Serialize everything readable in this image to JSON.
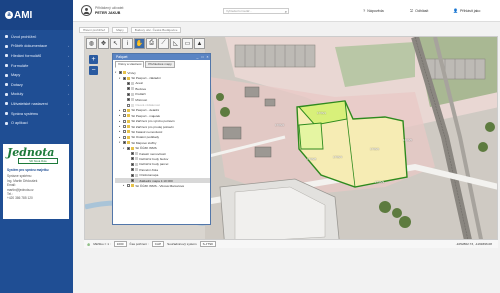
{
  "app": {
    "logo": "AMI",
    "logo_mark": "a"
  },
  "sidebar": {
    "items": [
      {
        "label": "Úvod prohlížeč",
        "has_children": false
      },
      {
        "label": "Průběh dokumentace",
        "has_children": true
      },
      {
        "label": "Hledání formulářů",
        "has_children": true
      },
      {
        "label": "Formuláře",
        "has_children": true
      },
      {
        "label": "Mapy",
        "has_children": true
      },
      {
        "label": "Dotazy",
        "has_children": true
      },
      {
        "label": "Moduly",
        "has_children": true
      },
      {
        "label": "Uživatelské nastavení",
        "has_children": true
      },
      {
        "label": "Správa systému",
        "has_children": true
      },
      {
        "label": "O aplikaci",
        "has_children": false
      }
    ],
    "branding": {
      "logo": "Jednota",
      "logo_sub": "SD Nová Role",
      "title": "Systém pro správu majetku",
      "lines": [
        "Správce systému",
        "Ing. Martin Dědoušek",
        "Email:",
        "martin@jednota.cz",
        "Tel.:",
        "+420 386 785 120"
      ]
    }
  },
  "topbar": {
    "user_label": "Přihlášený uživatel:",
    "user_name": "PETER JAKUB",
    "search_placeholder": "Vyhledat formulář...",
    "actions": [
      {
        "icon": "help-icon",
        "glyph": "?",
        "label": "Nápověda"
      },
      {
        "icon": "logout-icon",
        "glyph": "⎋",
        "label": "Odhlásit"
      },
      {
        "icon": "account-icon",
        "glyph": "👤",
        "label": "Přihlásit jako"
      }
    ]
  },
  "breadcrumbs": [
    "Hlavní prohlížeč",
    "Mapy",
    "Budovy obc. České Budějovice"
  ],
  "map": {
    "toolbar_tools": [
      {
        "icon": "globe-icon",
        "glyph": "◍",
        "selected": false
      },
      {
        "icon": "pan-icon",
        "glyph": "✥",
        "selected": false
      },
      {
        "icon": "pointer-icon",
        "glyph": "↖",
        "selected": false
      },
      {
        "icon": "info-icon",
        "glyph": "i",
        "selected": false
      },
      {
        "icon": "hand-icon",
        "glyph": "✋",
        "selected": true
      },
      {
        "icon": "print-icon",
        "glyph": "⎙",
        "selected": false
      },
      {
        "icon": "measure-length-icon",
        "glyph": "⟋",
        "selected": false
      },
      {
        "icon": "measure-area-icon",
        "glyph": "◺",
        "selected": false
      },
      {
        "icon": "ruler-icon",
        "glyph": "▭",
        "selected": false
      },
      {
        "icon": "marker-icon",
        "glyph": "▲",
        "selected": false
      }
    ],
    "zoom_in": "+",
    "zoom_out": "−",
    "parcel_labels": [
      "1766/1",
      "1766/4",
      "1766/6",
      "1766/2",
      "1766/5",
      "1766/8",
      "1766/9"
    ]
  },
  "layers": {
    "title": "Palquet",
    "buttons": {
      "minimize": "_",
      "maximize": "□",
      "close": "×"
    },
    "tabs": [
      {
        "label": "Vrstvy a vlastnost"
      },
      {
        "label": "Přehledové mapy"
      }
    ],
    "tree": [
      {
        "indent": 0,
        "expand": "▾",
        "checked": true,
        "icon_color": "#e6c24a",
        "label": "Vrstvy",
        "dim": false,
        "selected": false
      },
      {
        "indent": 1,
        "expand": "▾",
        "checked": true,
        "icon_color": "#e6c24a",
        "label": "Sit Pasport - základní",
        "dim": false,
        "selected": false
      },
      {
        "indent": 2,
        "expand": "",
        "checked": true,
        "icon_color": "#cfcfcf",
        "label": "Areál",
        "dim": false,
        "selected": false
      },
      {
        "indent": 2,
        "expand": "",
        "checked": true,
        "icon_color": "#cfcfcf",
        "label": "Budova",
        "dim": false,
        "selected": false
      },
      {
        "indent": 2,
        "expand": "",
        "checked": true,
        "icon_color": "#cfcfcf",
        "label": "Podlaží",
        "dim": false,
        "selected": false
      },
      {
        "indent": 2,
        "expand": "",
        "checked": true,
        "icon_color": "#cfcfcf",
        "label": "Místnost",
        "dim": false,
        "selected": false
      },
      {
        "indent": 2,
        "expand": "",
        "checked": false,
        "icon_color": "#e0e0e0",
        "label": "Osová vzdálenost",
        "dim": true,
        "selected": false
      },
      {
        "indent": 1,
        "expand": "▸",
        "checked": false,
        "icon_color": "#e6c24a",
        "label": "Sit Pasport - detailní",
        "dim": false,
        "selected": false
      },
      {
        "indent": 1,
        "expand": "▸",
        "checked": false,
        "icon_color": "#e6c24a",
        "label": "Sit Pasport - majetek",
        "dim": false,
        "selected": false
      },
      {
        "indent": 1,
        "expand": "▸",
        "checked": false,
        "icon_color": "#e6c24a",
        "label": "Sit Zařízení pro výrobu potravin",
        "dim": false,
        "selected": false
      },
      {
        "indent": 1,
        "expand": "▸",
        "checked": false,
        "icon_color": "#e6c24a",
        "label": "Sit Zařízení pro prodej potravin",
        "dim": false,
        "selected": false
      },
      {
        "indent": 1,
        "expand": "▸",
        "checked": false,
        "icon_color": "#e6c24a",
        "label": "Sit Katastr nemovitostí",
        "dim": false,
        "selected": false
      },
      {
        "indent": 1,
        "expand": "▸",
        "checked": false,
        "icon_color": "#e6c24a",
        "label": "Sit Ostatní podklady",
        "dim": false,
        "selected": false
      },
      {
        "indent": 1,
        "expand": "▾",
        "checked": true,
        "icon_color": "#e6c24a",
        "label": "Sit Mapové služby",
        "dim": false,
        "selected": false
      },
      {
        "indent": 2,
        "expand": "▾",
        "checked": true,
        "icon_color": "#e6c24a",
        "label": "Sit ČÚZK WMS",
        "dim": false,
        "selected": false
      },
      {
        "indent": 3,
        "expand": "",
        "checked": true,
        "icon_color": "#cfcfcf",
        "label": "Katastr nemovitostí",
        "dim": false,
        "selected": false
      },
      {
        "indent": 3,
        "expand": "",
        "checked": true,
        "icon_color": "#cfcfcf",
        "label": "Definiční body budov",
        "dim": false,
        "selected": false
      },
      {
        "indent": 3,
        "expand": "",
        "checked": true,
        "icon_color": "#cfcfcf",
        "label": "Definiční body parcel",
        "dim": false,
        "selected": false
      },
      {
        "indent": 3,
        "expand": "",
        "checked": true,
        "icon_color": "#cfcfcf",
        "label": "Parcelní čísla",
        "dim": false,
        "selected": false
      },
      {
        "indent": 3,
        "expand": "",
        "checked": true,
        "icon_color": "#cfcfcf",
        "label": "Ortofotomapa",
        "dim": false,
        "selected": false
      },
      {
        "indent": 3,
        "expand": "",
        "checked": true,
        "icon_color": "#cfcfcf",
        "label": "Základní mapa 1:10 000",
        "dim": false,
        "selected": true
      },
      {
        "indent": 2,
        "expand": "▸",
        "checked": false,
        "icon_color": "#e6c24a",
        "label": "Sit ČÚZK WMS - Vlková Marcelová",
        "dim": false,
        "selected": false
      }
    ]
  },
  "statusbar": {
    "scale_label": "Měřítko = 1 :",
    "scale_value": "1000",
    "time_label": "Čas pořízení :",
    "time_value": "CAP",
    "coord_label": "Souřadnicový systém",
    "coord_value": "S-JTSK",
    "coords": "-1052862.73, -1169396.08"
  },
  "colors": {
    "sidebar": "#1f4e94",
    "highlight": "#d8f07a",
    "parcel_outline": "#2e8a1e"
  }
}
